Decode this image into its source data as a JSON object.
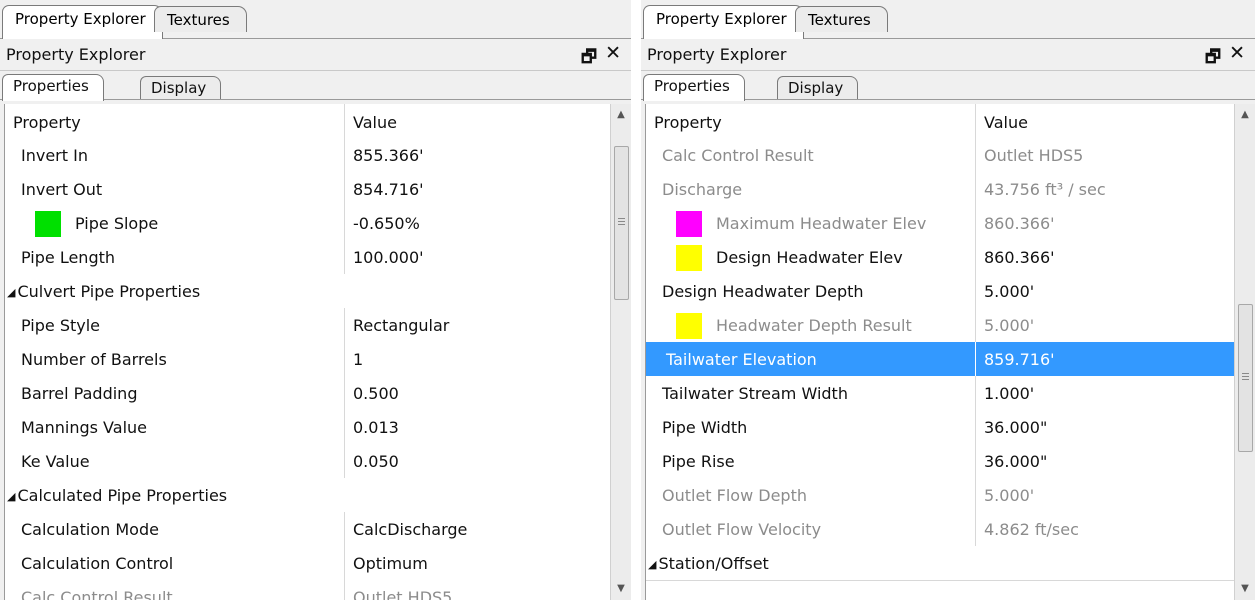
{
  "left": {
    "tabs": [
      "Property Explorer",
      "Textures"
    ],
    "title": "Property Explorer",
    "pin": "🗗",
    "close": "✕",
    "subtabs": [
      "Properties",
      "Display"
    ],
    "header": {
      "property": "Property",
      "value": "Value"
    },
    "rows": [
      {
        "label": "Invert In",
        "value": "855.366'"
      },
      {
        "label": "Invert Out",
        "value": "854.716'"
      },
      {
        "label": "Pipe Slope",
        "value": "-0.650%",
        "swatch": "#00e000"
      },
      {
        "label": "Pipe Length",
        "value": "100.000'"
      },
      {
        "category": "Culvert Pipe Properties"
      },
      {
        "label": "Pipe Style",
        "value": "Rectangular"
      },
      {
        "label": "Number of Barrels",
        "value": "1"
      },
      {
        "label": "Barrel Padding",
        "value": "0.500"
      },
      {
        "label": "Mannings Value",
        "value": "0.013"
      },
      {
        "label": "Ke Value",
        "value": "0.050"
      },
      {
        "category": "Calculated Pipe Properties"
      },
      {
        "label": "Calculation Mode",
        "value": "CalcDischarge"
      },
      {
        "label": "Calculation Control",
        "value": "Optimum"
      },
      {
        "label": "Calc Control Result",
        "value": "Outlet HDS5",
        "dim": true
      }
    ]
  },
  "right": {
    "tabs": [
      "Property Explorer",
      "Textures"
    ],
    "title": "Property Explorer",
    "pin": "🗗",
    "close": "✕",
    "subtabs": [
      "Properties",
      "Display"
    ],
    "header": {
      "property": "Property",
      "value": "Value"
    },
    "rows": [
      {
        "label": "Calc Control Result",
        "value": "Outlet HDS5",
        "dim": true
      },
      {
        "label": "Discharge",
        "value": "43.756 ft³ / sec",
        "dim": true
      },
      {
        "label": "Maximum Headwater Elev",
        "value": "860.366'",
        "dim": true,
        "swatch": "#ff00ff"
      },
      {
        "label": "Design Headwater Elev",
        "value": "860.366'",
        "swatch": "#ffff00"
      },
      {
        "label": "Design Headwater Depth",
        "value": "5.000'"
      },
      {
        "label": "Headwater Depth Result",
        "value": "5.000'",
        "dim": true,
        "swatch": "#ffff00"
      },
      {
        "label": "Tailwater Elevation",
        "value": "859.716'",
        "selected": true
      },
      {
        "label": "Tailwater Stream Width",
        "value": "1.000'"
      },
      {
        "label": "Pipe Width",
        "value": "36.000\""
      },
      {
        "label": "Pipe Rise",
        "value": "36.000\""
      },
      {
        "label": "Outlet Flow Depth",
        "value": "5.000'",
        "dim": true
      },
      {
        "label": "Outlet Flow Velocity",
        "value": "4.862 ft/sec",
        "dim": true
      },
      {
        "category": "Station/Offset"
      }
    ]
  }
}
